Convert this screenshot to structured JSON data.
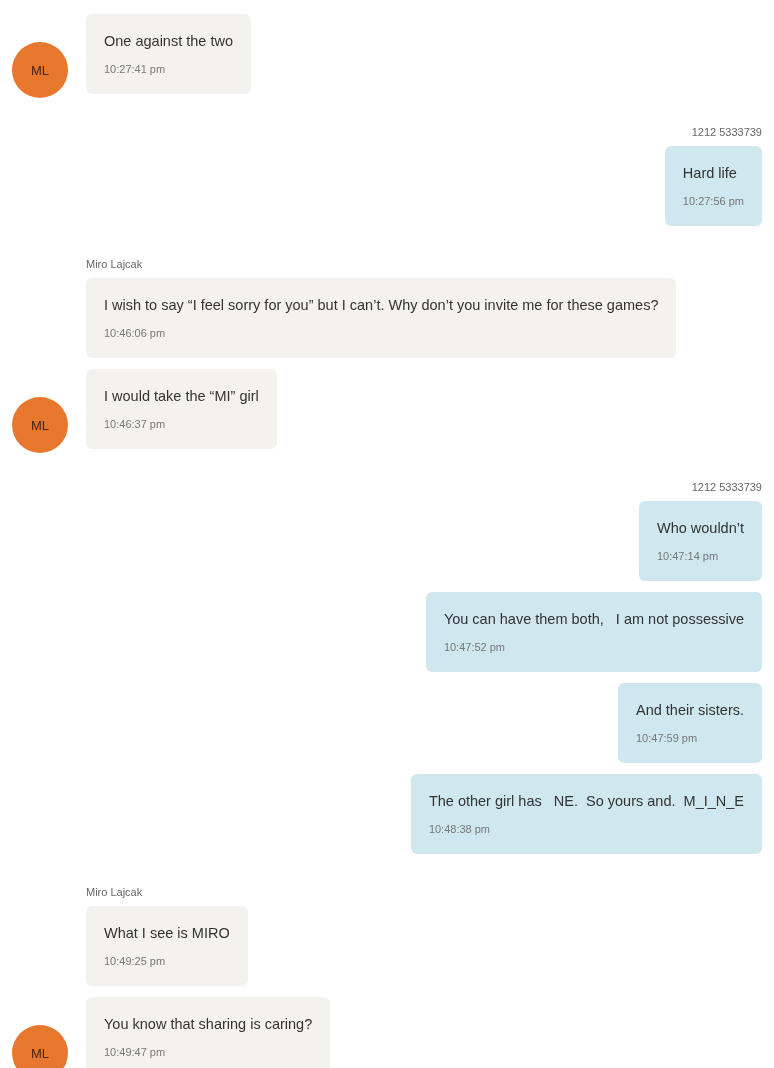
{
  "conversation": [
    {
      "kind": "incoming",
      "messages": [
        {
          "text": "One against the two",
          "time": "10:27:41 pm",
          "avatar": "ML"
        }
      ]
    },
    {
      "kind": "outgoing",
      "sender": "1212 5333739",
      "messages": [
        {
          "text": "Hard life",
          "time": "10:27:56 pm"
        }
      ]
    },
    {
      "kind": "incoming",
      "sender": "Miro Lajcak",
      "messages": [
        {
          "text": "I wish to say “I feel sorry for you” but I can’t. Why don’t you invite me for these games?",
          "time": "10:46:06 pm"
        },
        {
          "text": "I would take the “MI” girl",
          "time": "10:46:37 pm",
          "avatar": "ML"
        }
      ]
    },
    {
      "kind": "outgoing",
      "sender": "1212 5333739",
      "messages": [
        {
          "text": "Who wouldn’t",
          "time": "10:47:14 pm"
        },
        {
          "text": "You can have them both,   I am not possessive",
          "time": "10:47:52 pm"
        },
        {
          "text": "And their sisters.",
          "time": "10:47:59 pm"
        },
        {
          "text": "The other girl has   NE.  So yours and.  M_I_N_E",
          "time": "10:48:38 pm"
        }
      ]
    },
    {
      "kind": "incoming",
      "sender": "Miro Lajcak",
      "messages": [
        {
          "text": "What I see is MIRO",
          "time": "10:49:25 pm"
        },
        {
          "text": "You know that sharing is caring?",
          "time": "10:49:47 pm",
          "avatar": "ML"
        }
      ]
    }
  ]
}
